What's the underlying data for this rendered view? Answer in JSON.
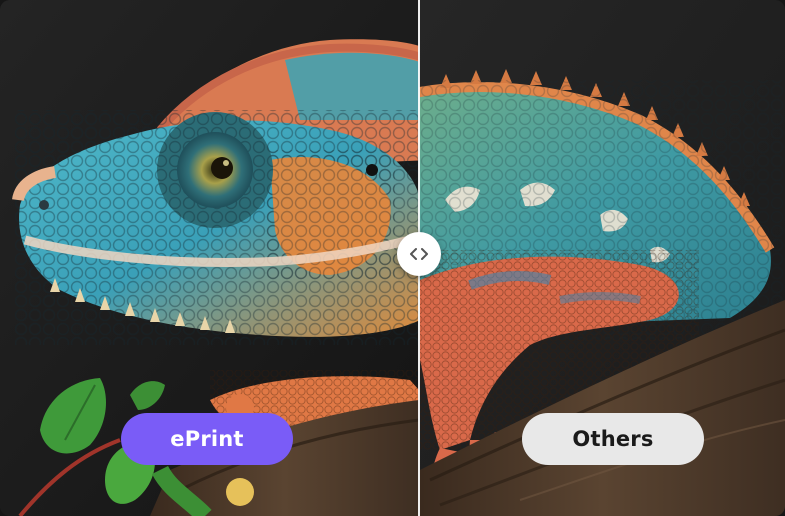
{
  "comparison": {
    "left_label": "ePrint",
    "right_label": "Others",
    "handle_icon": "chevron-left-right-icon",
    "colors": {
      "eprint_badge": "#7a5cf7",
      "others_badge": "#e8e8e8",
      "background": "#161616"
    }
  }
}
